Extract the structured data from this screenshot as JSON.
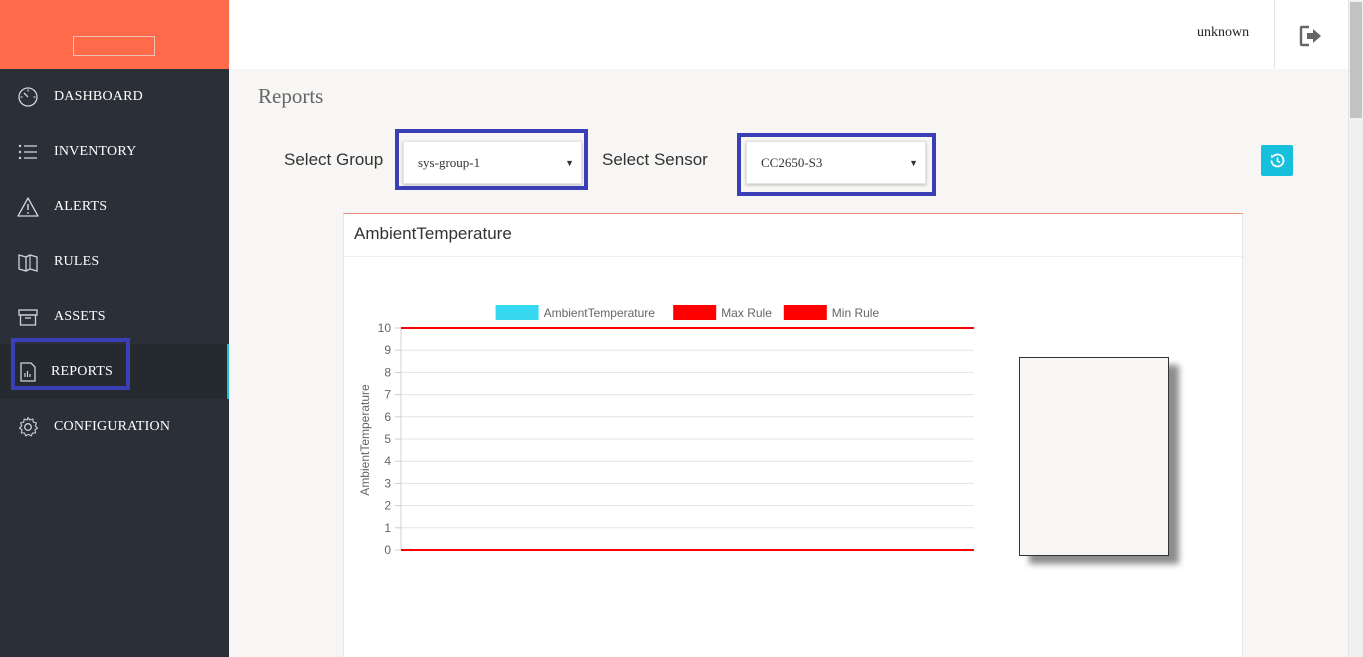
{
  "sidebar": {
    "items": [
      {
        "label": "DASHBOARD",
        "icon": "dashboard-gauge-icon"
      },
      {
        "label": "INVENTORY",
        "icon": "list-icon"
      },
      {
        "label": "ALERTS",
        "icon": "warning-triangle-icon"
      },
      {
        "label": "RULES",
        "icon": "book-icon"
      },
      {
        "label": "ASSETS",
        "icon": "box-icon"
      },
      {
        "label": "REPORTS",
        "icon": "report-chart-icon",
        "active": true
      },
      {
        "label": "CONFIGURATION",
        "icon": "gear-icon"
      }
    ]
  },
  "header": {
    "user": "unknown",
    "logout_icon": "logout-icon"
  },
  "main": {
    "title": "Reports",
    "group_label": "Select Group",
    "group_value": "sys-group-1",
    "sensor_label": "Select Sensor",
    "sensor_value": "CC2650-S3",
    "refresh_icon": "history-icon"
  },
  "card": {
    "title": "AmbientTemperature"
  },
  "colors": {
    "brand": "#ff6a4a",
    "sidebar_bg": "#2b3038",
    "accent": "#16c0dc",
    "highlight": "#3b3fb5",
    "series_ambient": "#36d9ef",
    "series_rule": "#ff0000"
  },
  "chart_data": {
    "type": "line",
    "ylabel": "AmbientTemperature",
    "ylim": [
      0,
      10
    ],
    "y_ticks": [
      "0",
      "1",
      "2",
      "3",
      "4",
      "5",
      "6",
      "7",
      "8",
      "9",
      "10"
    ],
    "legend_position": "top",
    "series": [
      {
        "name": "AmbientTemperature",
        "color": "#36d9ef",
        "values": []
      },
      {
        "name": "Max Rule",
        "color": "#ff0000",
        "values": [
          10
        ]
      },
      {
        "name": "Min Rule",
        "color": "#ff0000",
        "values": [
          0
        ]
      }
    ]
  }
}
